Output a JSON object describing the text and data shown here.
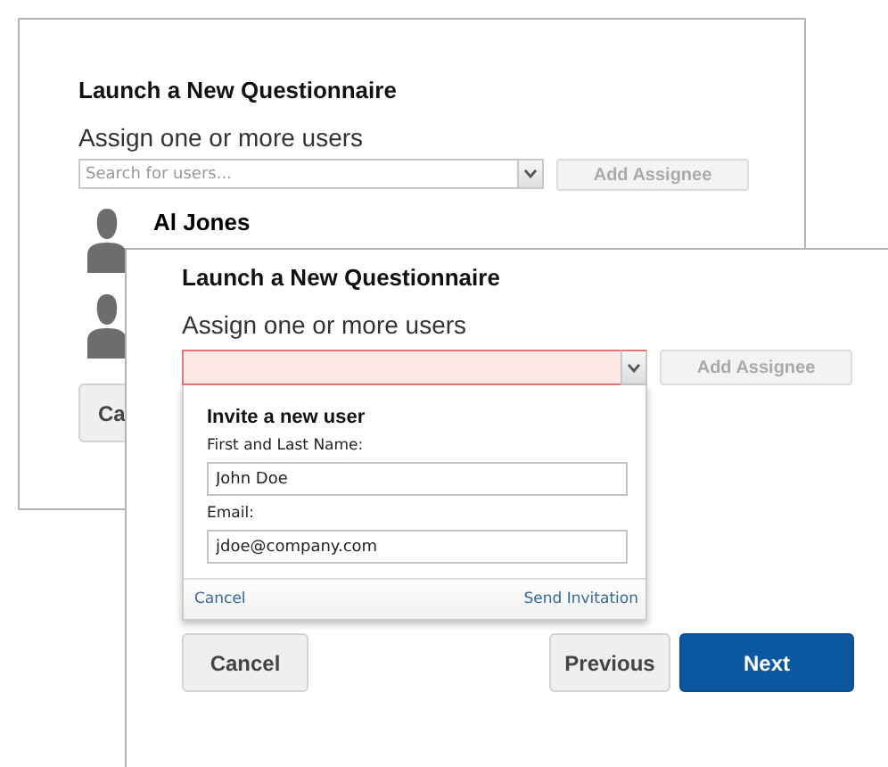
{
  "back_panel": {
    "title": "Launch a New Questionnaire",
    "subtitle": "Assign one or more users",
    "search": {
      "placeholder": "Search for users...",
      "invalid": false
    },
    "add_button": {
      "label": "Add Assignee",
      "disabled": true
    },
    "users": [
      {
        "kind": "named",
        "name": "Al Jones"
      },
      {
        "kind": "covered"
      }
    ],
    "cancel_button": "Ca"
  },
  "front_panel": {
    "title": "Launch a New Questionnaire",
    "subtitle": "Assign one or more users",
    "search": {
      "invalid": true
    },
    "add_button": {
      "label": "Add Assignee",
      "disabled": true
    },
    "invite": {
      "heading": "Invite a new user",
      "name_label": "First and Last Name:",
      "name_value": "John Doe",
      "email_label": "Email:",
      "email_value": "jdoe@company.com",
      "cancel_link": "Cancel",
      "send_link": "Send Invitation"
    },
    "buttons": [
      {
        "label": "Cancel",
        "kind": "secondary"
      },
      {
        "label": "Previous",
        "kind": "secondary"
      },
      {
        "label": "Next",
        "kind": "primary"
      }
    ]
  }
}
